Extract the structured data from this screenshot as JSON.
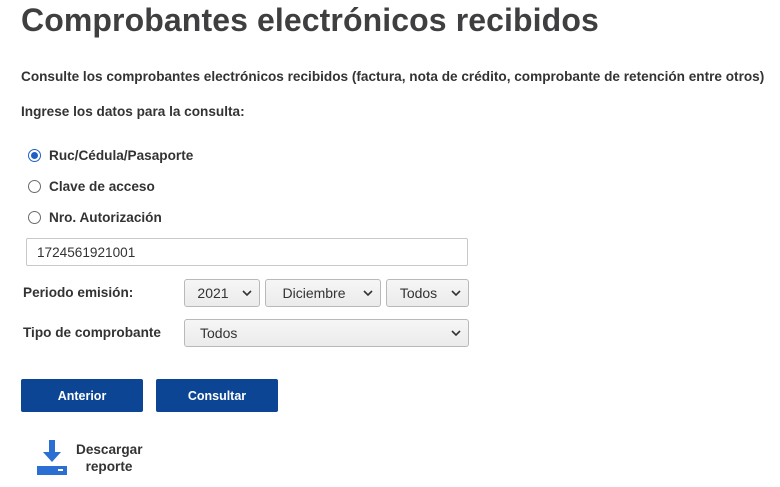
{
  "page": {
    "title": "Comprobantes electrónicos recibidos",
    "description": "Consulte los comprobantes electrónicos recibidos (factura, nota de crédito, comprobante de retención entre otros)",
    "prompt": "Ingrese los datos para la consulta:"
  },
  "search_type": {
    "options": [
      {
        "label": "Ruc/Cédula/Pasaporte",
        "checked": true
      },
      {
        "label": "Clave de acceso",
        "checked": false
      },
      {
        "label": "Nro. Autorización",
        "checked": false
      }
    ]
  },
  "id_input": {
    "value": "1724561921001"
  },
  "period": {
    "label": "Periodo emisión:",
    "year": "2021",
    "month": "Diciembre",
    "day": "Todos"
  },
  "voucher_type": {
    "label": "Tipo de comprobante",
    "value": "Todos"
  },
  "buttons": {
    "back": "Anterior",
    "search": "Consultar"
  },
  "download": {
    "line1": "Descargar",
    "line2": "reporte"
  },
  "colors": {
    "primary": "#0d4595",
    "radio_accent": "#1f5fc6",
    "download_icon": "#2a6fd1"
  },
  "icons": [
    "radio-selected-icon",
    "radio-unselected-icon",
    "chevron-down-icon",
    "download-icon"
  ]
}
